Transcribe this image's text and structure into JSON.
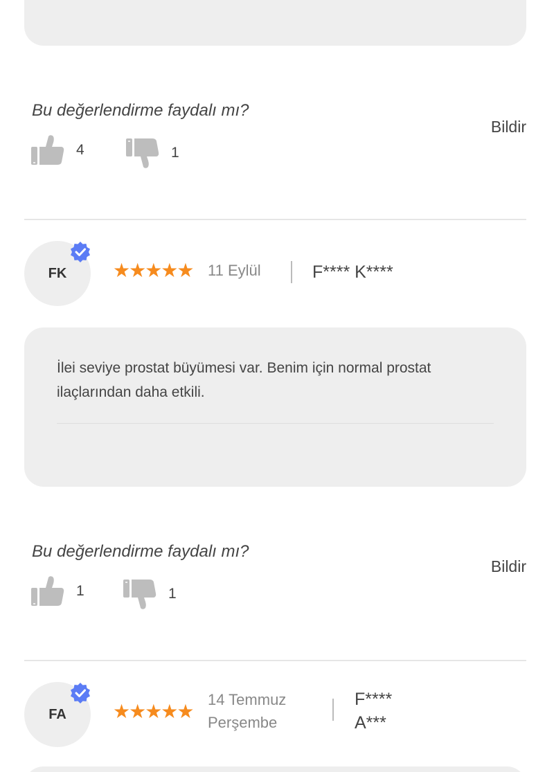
{
  "review1": {
    "helpful_question": "Bu değerlendirme faydalı mı?",
    "report_label": "Bildir",
    "likes": "4",
    "dislikes": "1"
  },
  "review2": {
    "initials": "FK",
    "stars": "★★★★★",
    "rating": 5,
    "date": "11 Eylül",
    "author": "F**** K****",
    "text": "İlei seviye prostat büyümesi var. Benim için normal prostat ilaçlarından daha etkili.",
    "helpful_question": "Bu değerlendirme faydalı mı?",
    "report_label": "Bildir",
    "likes": "1",
    "dislikes": "1"
  },
  "review3": {
    "initials": "FA",
    "stars": "★★★★★",
    "rating": 5,
    "date_line1": "14 Temmuz",
    "date_line2": "Perşembe",
    "author_line1": "F****",
    "author_line2": "A***"
  },
  "colors": {
    "star": "#f68b1e",
    "verified_badge": "#5b7cf5",
    "card_bg": "#eeeeee"
  },
  "icons": {
    "like": "thumbs-up-icon",
    "dislike": "thumbs-down-icon",
    "verified": "verified-badge-icon"
  }
}
